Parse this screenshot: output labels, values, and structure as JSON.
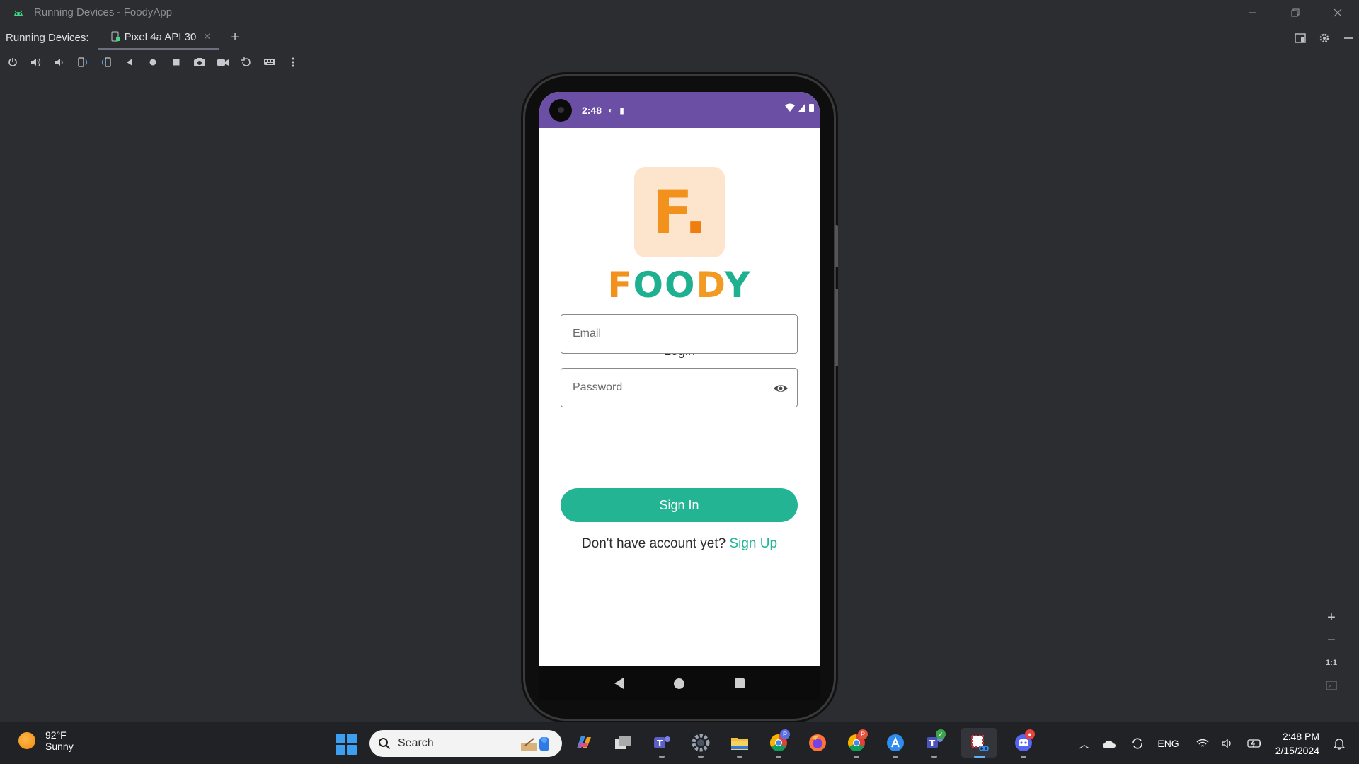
{
  "window": {
    "title": "Running Devices - FoodyApp"
  },
  "tabs_row": {
    "label": "Running Devices:",
    "tabs": [
      {
        "label": "Pixel 4a API 30"
      }
    ],
    "add_label": "+"
  },
  "toolbar": {
    "icons": [
      "power-icon",
      "volume-up-icon",
      "volume-down-icon",
      "rotate-left-icon",
      "rotate-right-icon",
      "back-icon",
      "home-icon",
      "overview-icon",
      "screenshot-icon",
      "screen-record-icon",
      "reset-icon",
      "keyboard-icon",
      "more-icon"
    ]
  },
  "device": {
    "status_bar": {
      "time": "2:48",
      "left_icons": [
        "sync-icon",
        "sd-card-icon"
      ],
      "right_icons": [
        "wifi-icon",
        "signal-icon",
        "battery-icon"
      ],
      "color": "#6a4fa4"
    },
    "app": {
      "logo_letter": "F",
      "logo_dot": ".",
      "brand": {
        "f": "F",
        "o1": "O",
        "o2": "O",
        "d": "D",
        "y": "Y"
      },
      "login_title": "Login",
      "email": {
        "placeholder": "Email",
        "value": ""
      },
      "password": {
        "placeholder": "Password",
        "value": ""
      },
      "sign_in_label": "Sign In",
      "signup_prompt": "Don't have account yet?",
      "signup_link": "Sign Up",
      "accent_color": "#23b494",
      "logo_color": "#f2921c"
    },
    "nav_bar": [
      "back-icon",
      "home-icon",
      "recents-icon"
    ]
  },
  "zoom_controls": {
    "zoom_in": "+",
    "zoom_out": "−",
    "actual_size": "1:1",
    "fit_screen": "fit-screen-icon"
  },
  "taskbar": {
    "weather": {
      "temp": "92°F",
      "condition": "Sunny"
    },
    "search_placeholder": "Search",
    "apps": [
      "copilot-icon",
      "task-view-icon",
      "teams-icon",
      "settings-icon",
      "file-explorer-icon",
      "chrome-icon",
      "firefox-icon",
      "chrome-profile-icon",
      "app-store-icon",
      "teams-work-icon",
      "snipping-tool-icon",
      "discord-icon"
    ],
    "tray": {
      "language": "ENG",
      "time": "2:48 PM",
      "date": "2/15/2024"
    }
  }
}
